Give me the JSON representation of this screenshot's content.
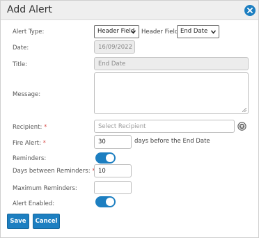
{
  "dialog": {
    "title": "Add Alert",
    "close_icon": "close-circle-icon"
  },
  "form": {
    "alert_type": {
      "label": "Alert Type:",
      "value": "Header Field"
    },
    "header_field": {
      "label": "Header Field:",
      "value": "End Date"
    },
    "date": {
      "label": "Date:",
      "value": "16/09/2022"
    },
    "title": {
      "label": "Title:",
      "value": "End Date"
    },
    "message": {
      "label": "Message:",
      "value": ""
    },
    "recipient": {
      "label": "Recipient:",
      "required_mark": "*",
      "placeholder": "Select Recipient",
      "clear_icon": "clear-circle-icon"
    },
    "fire_alert": {
      "label": "Fire Alert:",
      "required_mark": "*",
      "value": "30",
      "suffix": "days before the End Date"
    },
    "reminders": {
      "label": "Reminders:",
      "enabled": true
    },
    "days_between_reminders": {
      "label": "Days between Reminders:",
      "required_mark": "*",
      "value": "10"
    },
    "maximum_reminders": {
      "label": "Maximum Reminders:",
      "value": ""
    },
    "alert_enabled": {
      "label": "Alert Enabled:",
      "enabled": true
    }
  },
  "buttons": {
    "save": "Save",
    "cancel": "Cancel"
  },
  "colors": {
    "accent": "#1d7fc1",
    "required": "#d9534f"
  }
}
